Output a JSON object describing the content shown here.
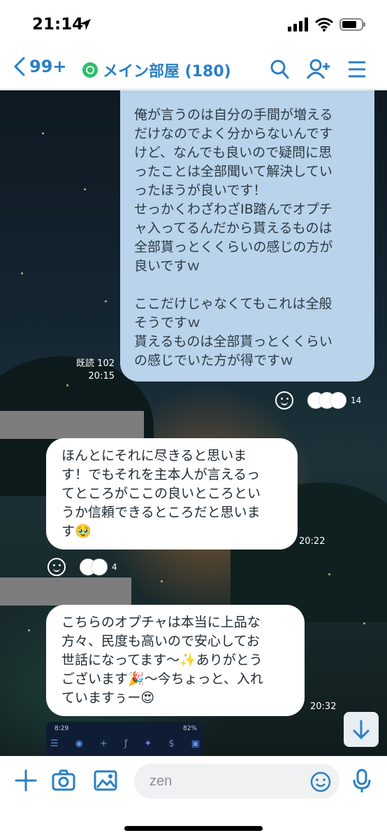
{
  "status_bar": {
    "time": "21:14"
  },
  "header": {
    "back_count": "99+",
    "room_name": "メイン部屋 (180)"
  },
  "messages": [
    {
      "sender": "me",
      "text": "俺が言うのは自分の手間が増える\nだけなのでよく分からないんです\nけど、なんでも良いので疑問に思\nったことは全部聞いて解決してい\nったほうが良いです！\nせっかくわざわざIB踏んでオプチ\nャ入ってるんだから貰えるものは\n全部貰っとくくらいの感じの方が\n良いですｗ\n\nここだけじゃなくてもこれは全般\nそうですｗ\n貰えるものは全部貰っとくくらい\nの感じでいた方が得ですｗ",
      "read_label": "既読 102",
      "time": "20:15",
      "reaction_count": "14"
    },
    {
      "sender": "other",
      "text": "ほんとにそれに尽きると思いま\nす！でもそれを主本人が言えるっ\nてところがここの良いところとい\nうか信頼できるところだと思いま\nす🥹",
      "time": "20:22",
      "reaction_count": "4"
    },
    {
      "sender": "other",
      "text": "こちらのオプチャは本当に上品な\n方々、民度も高いので安心してお\n世話になってます〜✨ありがとう\nございます🎉〜今ちょっと、入れ\nていますぅー😍",
      "time": "20:32"
    }
  ],
  "embedded_screenshot": {
    "time": "8:29",
    "battery": "82%"
  },
  "input": {
    "value": "zen"
  },
  "icons": {
    "status": [
      "location-arrow-icon",
      "signal-icon",
      "wifi-icon",
      "battery-icon"
    ],
    "header": [
      "search-icon",
      "add-friend-icon",
      "menu-icon"
    ],
    "input_bar": [
      "plus-icon",
      "camera-icon",
      "image-icon",
      "emoji-icon",
      "mic-icon"
    ]
  },
  "colors": {
    "accent": "#2a7fc6",
    "my_bubble": "#b8d3ea",
    "other_bubble": "#ffffff",
    "open_chat_badge": "#2bbf6b"
  }
}
